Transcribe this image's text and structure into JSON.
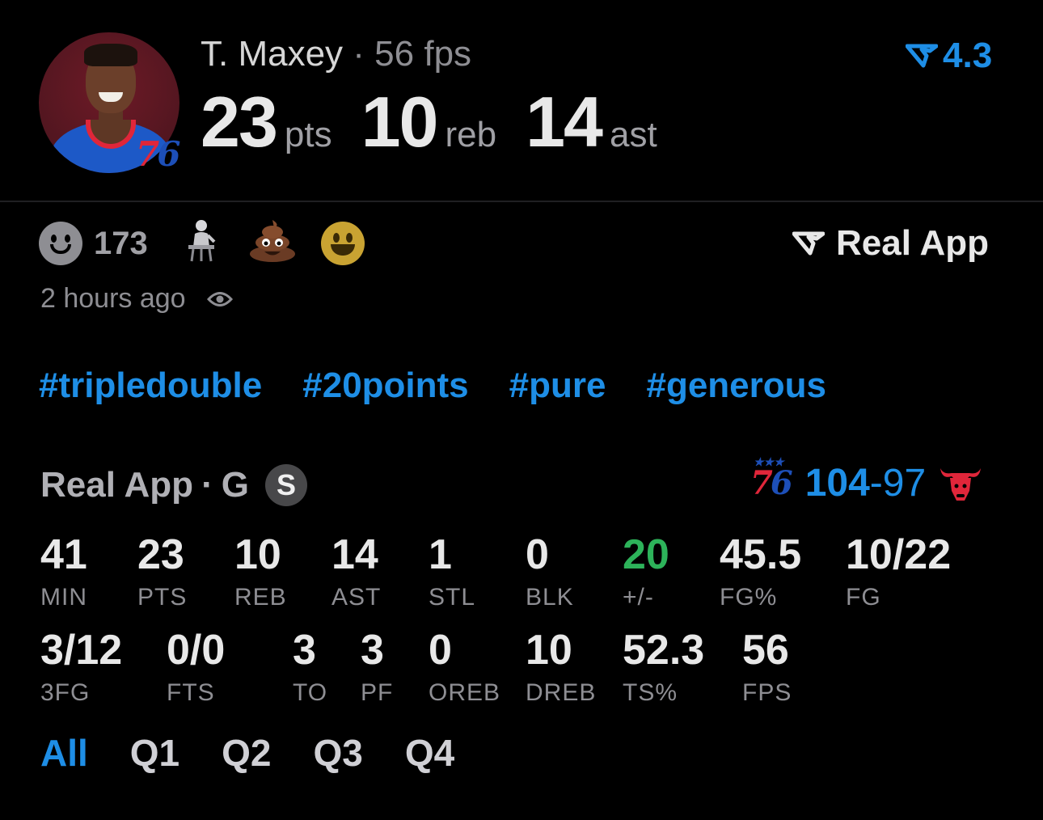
{
  "player": {
    "name": "T. Maxey",
    "separator": "·",
    "fps_text": "56 fps",
    "team_logo": "76",
    "rating": "4.3"
  },
  "headline_stats": [
    {
      "value": "23",
      "unit": "pts"
    },
    {
      "value": "10",
      "unit": "reb"
    },
    {
      "value": "14",
      "unit": "ast"
    }
  ],
  "reactions": {
    "count": "173",
    "emojis": [
      "person-at-desk-emoji",
      "poo-emoji",
      "grinning-emoji"
    ]
  },
  "brand": {
    "label": "Real App"
  },
  "post_meta": {
    "time": "2 hours ago"
  },
  "hashtags": [
    "#tripledouble",
    "#20points",
    "#pure",
    "#generous"
  ],
  "box_header": {
    "source": "Real App",
    "separator": "·",
    "position": "G",
    "badge": "S"
  },
  "game_score": {
    "home_logo": "76",
    "home": "104",
    "dash": "-",
    "away": "97"
  },
  "stats_row1": [
    {
      "value": "41",
      "label": "MIN"
    },
    {
      "value": "23",
      "label": "PTS"
    },
    {
      "value": "10",
      "label": "REB"
    },
    {
      "value": "14",
      "label": "AST"
    },
    {
      "value": "1",
      "label": "STL"
    },
    {
      "value": "0",
      "label": "BLK"
    },
    {
      "value": "20",
      "label": "+/-"
    },
    {
      "value": "45.5",
      "label": "FG%"
    },
    {
      "value": "10/22",
      "label": "FG"
    }
  ],
  "stats_row2": [
    {
      "value": "3/12",
      "label": "3FG"
    },
    {
      "value": "0/0",
      "label": "FTS"
    },
    {
      "value": "3",
      "label": "TO"
    },
    {
      "value": "3",
      "label": "PF"
    },
    {
      "value": "0",
      "label": "OREB"
    },
    {
      "value": "10",
      "label": "DREB"
    },
    {
      "value": "52.3",
      "label": "TS%"
    },
    {
      "value": "56",
      "label": "FPS"
    }
  ],
  "tabs": [
    "All",
    "Q1",
    "Q2",
    "Q3",
    "Q4"
  ],
  "active_tab": "All",
  "colors": {
    "accent": "#1e8ee6",
    "positive": "#2db35a",
    "muted": "#8e8e93",
    "background": "#000000"
  }
}
